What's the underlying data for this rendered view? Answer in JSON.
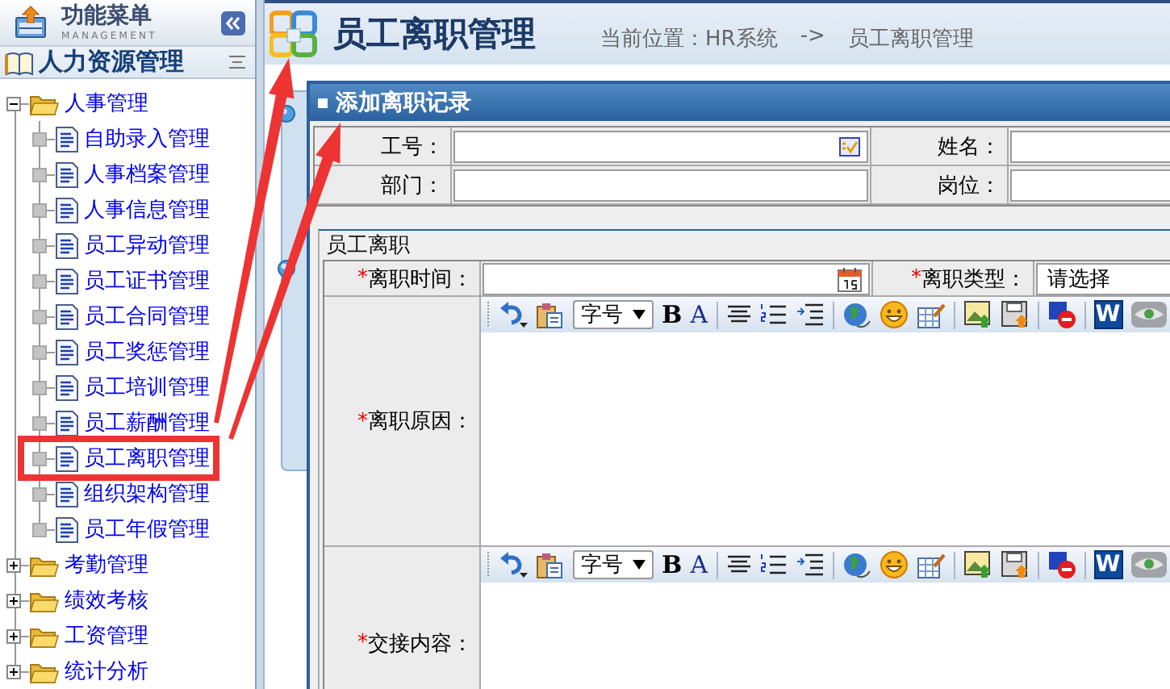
{
  "sidebar": {
    "title": "功能菜单",
    "subtitle": "MANAGEMENT",
    "section": "人力资源管理",
    "tree": [
      {
        "label": "人事管理",
        "expanded": true,
        "children": [
          {
            "label": "自助录入管理",
            "marked": false
          },
          {
            "label": "人事档案管理",
            "marked": false
          },
          {
            "label": "人事信息管理",
            "marked": false
          },
          {
            "label": "员工异动管理",
            "marked": false
          },
          {
            "label": "员工证书管理",
            "marked": false
          },
          {
            "label": "员工合同管理",
            "marked": false
          },
          {
            "label": "员工奖惩管理",
            "marked": false
          },
          {
            "label": "员工培训管理",
            "marked": false
          },
          {
            "label": "员工薪酬管理",
            "marked": false
          },
          {
            "label": "员工离职管理",
            "marked": true
          },
          {
            "label": "组织架构管理",
            "marked": false
          },
          {
            "label": "员工年假管理",
            "marked": false
          }
        ]
      },
      {
        "label": "考勤管理",
        "expanded": false
      },
      {
        "label": "绩效考核",
        "expanded": false
      },
      {
        "label": "工资管理",
        "expanded": false
      },
      {
        "label": "统计分析",
        "expanded": false
      }
    ]
  },
  "header": {
    "title": "员工离职管理",
    "breadcrumb": [
      "当前位置：HR系统",
      "->",
      "员工离职管理"
    ]
  },
  "dialog": {
    "title": "添加离职记录",
    "fields": [
      {
        "label": "工号：",
        "kind": "lookup"
      },
      {
        "label": "姓名：",
        "kind": "text"
      },
      {
        "label": "部门：",
        "kind": "text"
      },
      {
        "label": "岗位：",
        "kind": "text"
      }
    ],
    "section": {
      "legend": "员工离职",
      "fields": [
        {
          "label": "离职时间：",
          "required_mark": "*",
          "kind": "date"
        },
        {
          "label": "离职类型：",
          "required_mark": "*",
          "kind": "select",
          "value": "请选择"
        }
      ],
      "editors": [
        {
          "label": "离职原因：",
          "required_mark": "*",
          "toolbar": [
            {
              "kind": "grip"
            },
            {
              "kind": "undo"
            },
            {
              "kind": "paste"
            },
            {
              "kind": "select",
              "text": "字号"
            },
            {
              "kind": "bold",
              "glyph": "B"
            },
            {
              "kind": "font_color",
              "glyph": "A"
            },
            {
              "kind": "separator"
            },
            {
              "kind": "align"
            },
            {
              "kind": "numbered_list"
            },
            {
              "kind": "indent"
            },
            {
              "kind": "separator"
            },
            {
              "kind": "globe"
            },
            {
              "kind": "smiley"
            },
            {
              "kind": "table"
            },
            {
              "kind": "separator"
            },
            {
              "kind": "image"
            },
            {
              "kind": "save"
            },
            {
              "kind": "separator"
            },
            {
              "kind": "delete"
            },
            {
              "kind": "separator"
            },
            {
              "kind": "word",
              "glyph": "W"
            },
            {
              "kind": "eye"
            }
          ]
        },
        {
          "label": "交接内容：",
          "required_mark": "*",
          "toolbar": [
            {
              "kind": "grip"
            },
            {
              "kind": "undo"
            },
            {
              "kind": "paste"
            },
            {
              "kind": "select",
              "text": "字号"
            },
            {
              "kind": "bold",
              "glyph": "B"
            },
            {
              "kind": "font_color",
              "glyph": "A"
            },
            {
              "kind": "separator"
            },
            {
              "kind": "align"
            },
            {
              "kind": "numbered_list"
            },
            {
              "kind": "indent"
            },
            {
              "kind": "separator"
            },
            {
              "kind": "globe"
            },
            {
              "kind": "smiley"
            },
            {
              "kind": "table"
            },
            {
              "kind": "separator"
            },
            {
              "kind": "image"
            },
            {
              "kind": "save"
            },
            {
              "kind": "separator"
            },
            {
              "kind": "delete"
            },
            {
              "kind": "separator"
            },
            {
              "kind": "word",
              "glyph": "W"
            },
            {
              "kind": "eye"
            }
          ]
        }
      ]
    }
  }
}
